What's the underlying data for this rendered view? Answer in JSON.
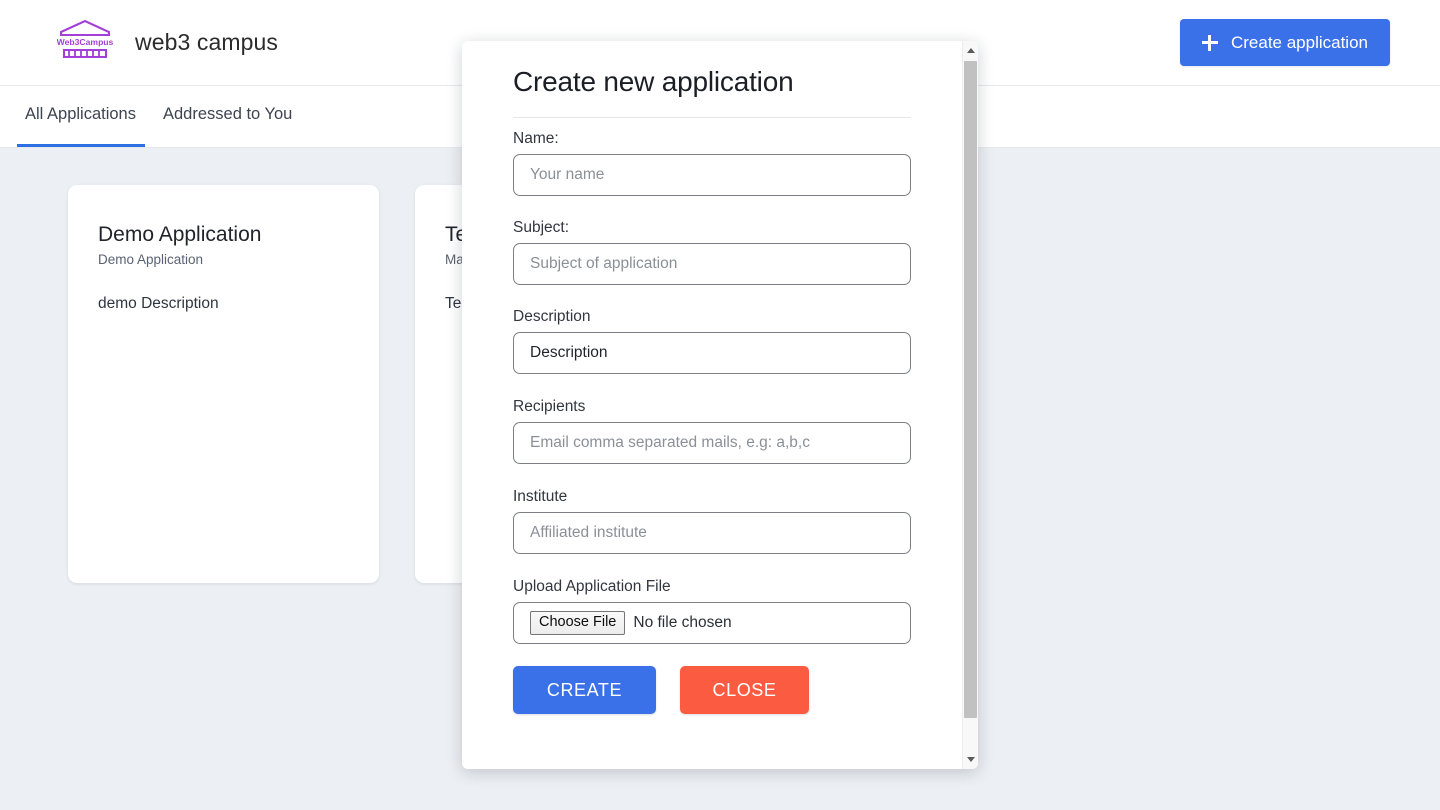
{
  "header": {
    "brand_title": "web3 campus",
    "logo_text": "Web3Campus",
    "logo_icon": "campus-building-icon",
    "create_button_label": "Create application",
    "create_button_icon": "plus-icon",
    "accent_color": "#3b71e8"
  },
  "tabs": [
    {
      "label": "All Applications",
      "active": true
    },
    {
      "label": "Addressed to You",
      "active": false
    }
  ],
  "cards": [
    {
      "title": "Demo Application",
      "subtitle": "Demo Application",
      "body": "demo Description"
    },
    {
      "title": "Te",
      "subtitle": "Ma",
      "body": "Te"
    }
  ],
  "modal": {
    "title": "Create new application",
    "fields": [
      {
        "label": "Name:",
        "placeholder": "Your name",
        "value": ""
      },
      {
        "label": "Subject:",
        "placeholder": "Subject of application",
        "value": ""
      },
      {
        "label": "Description",
        "placeholder": "Description",
        "value": "Description"
      },
      {
        "label": "Recipients",
        "placeholder": "Email comma separated mails, e.g: a,b,c",
        "value": ""
      },
      {
        "label": "Institute",
        "placeholder": "Affiliated institute",
        "value": ""
      }
    ],
    "upload": {
      "label": "Upload Application File",
      "choose_file_label": "Choose File",
      "no_file_text": "No file chosen"
    },
    "buttons": {
      "create_label": "CREATE",
      "create_color": "#3b71e8",
      "close_label": "CLOSE",
      "close_color": "#fb5c41"
    },
    "scrollbar": {
      "up_icon": "scroll-up-arrow-icon",
      "down_icon": "scroll-down-arrow-icon"
    }
  },
  "page": {
    "background_color": "#eceff3",
    "surface_color": "#ffffff"
  }
}
